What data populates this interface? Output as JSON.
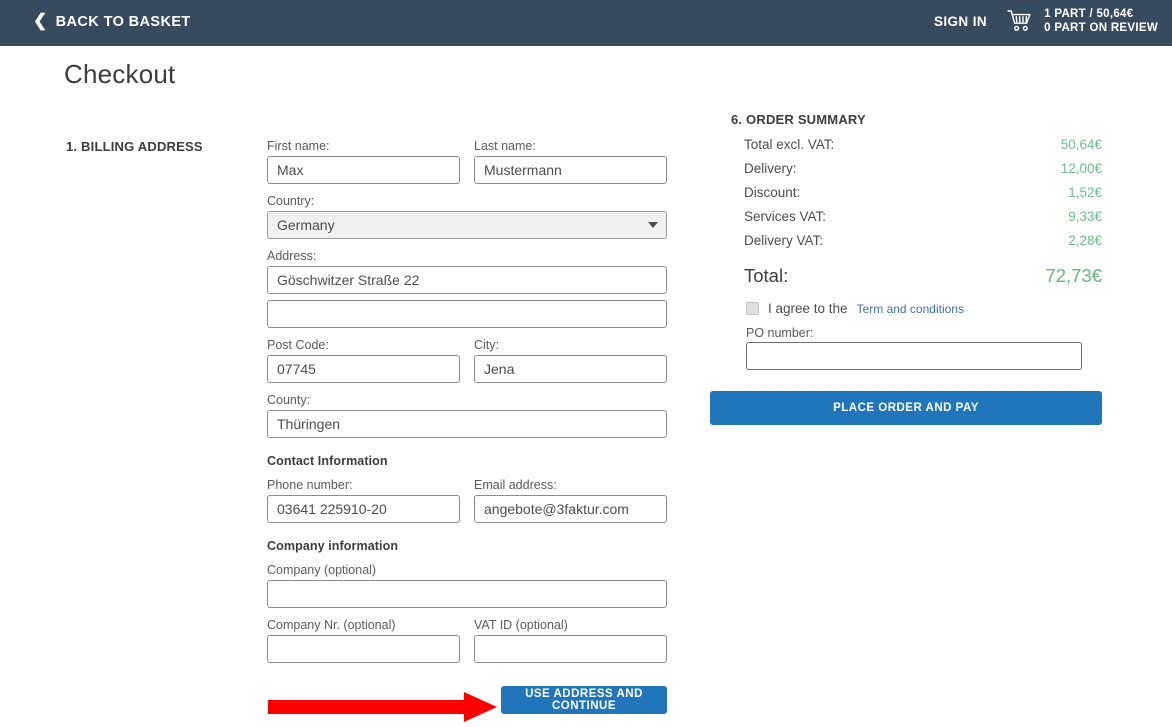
{
  "topbar": {
    "back_label": "BACK TO BASKET",
    "back_icon": "chevron-left-icon",
    "signin_label": "SIGN IN",
    "cart_icon": "shopping-cart-icon",
    "cart_line1": "1 PART / 50,64€",
    "cart_line2": "0 PART ON REVIEW",
    "background_color": "#374a5e"
  },
  "page": {
    "title": "Checkout"
  },
  "billing": {
    "section_heading": "1. BILLING ADDRESS",
    "first_name": {
      "label": "First name:",
      "value": "Max"
    },
    "last_name": {
      "label": "Last name:",
      "value": "Mustermann"
    },
    "country": {
      "label": "Country:",
      "value": "Germany"
    },
    "address": {
      "label": "Address:",
      "value": "Göschwitzer Straße 22"
    },
    "address2": {
      "label": "",
      "value": ""
    },
    "post_code": {
      "label": "Post Code:",
      "value": "07745"
    },
    "city": {
      "label": "City:",
      "value": "Jena"
    },
    "county": {
      "label": "County:",
      "value": "Thüringen"
    },
    "contact_heading": "Contact Information",
    "phone": {
      "label": "Phone number:",
      "value": "03641 225910-20"
    },
    "email": {
      "label": "Email address:",
      "value": "angebote@3faktur.com"
    },
    "company_heading": "Company information",
    "company": {
      "label": "Company (optional)",
      "value": ""
    },
    "company_nr": {
      "label": "Company Nr. (optional)",
      "value": ""
    },
    "vat_id": {
      "label": "VAT ID (optional)",
      "value": ""
    },
    "continue_button": "USE ADDRESS AND CONTINUE",
    "arrow_annotation_color": "#fa0000"
  },
  "summary": {
    "heading": "6. ORDER SUMMARY",
    "rows": [
      {
        "label": "Total excl. VAT:",
        "value": "50,64€"
      },
      {
        "label": "Delivery:",
        "value": "12,00€"
      },
      {
        "label": "Discount:",
        "value": "1,52€"
      },
      {
        "label": "Services VAT:",
        "value": "9,33€"
      },
      {
        "label": "Delivery VAT:",
        "value": "2,28€"
      }
    ],
    "total": {
      "label": "Total:",
      "value": "72,73€"
    },
    "agree_text": "I agree to the",
    "terms_link": "Term and conditions",
    "po_number": {
      "label": "PO number:",
      "value": ""
    },
    "place_order_button": "PLACE ORDER AND PAY",
    "value_color": "#6fbb8f",
    "accent_color": "#2175ba"
  }
}
